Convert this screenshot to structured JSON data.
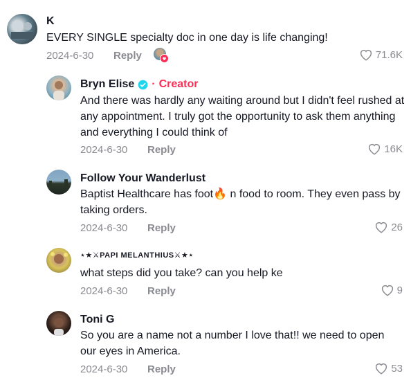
{
  "comments": [
    {
      "author": "K",
      "text": "EVERY SINGLE specialty doc in one day is life changing!",
      "date": "2024-6-30",
      "reply": "Reply",
      "likes": "71.6K"
    },
    {
      "author": "Bryn Elise",
      "creator_sep": "·",
      "creator_label": "Creator",
      "text": "And there was hardly any waiting around but I didn't feel rushed at any appointment. I truly got the opportunity to ask them anything and everything I could think of",
      "date": "2024-6-30",
      "reply": "Reply",
      "likes": "16K"
    },
    {
      "author": "Follow Your Wanderlust",
      "text_before": "Baptist Healthcare has foot",
      "emoji": "🔥",
      "text_after": " n food to room. They even pass by taking orders.",
      "date": "2024-6-30",
      "reply": "Reply",
      "likes": "26"
    },
    {
      "author": "⋆★⚔PAPI MELANTHIUS⚔★⋆",
      "text": "what steps did you take? can you help ke",
      "date": "2024-6-30",
      "reply": "Reply",
      "likes": "9"
    },
    {
      "author": "Toni G",
      "text": "So you are a name not a number I love that!! we need to open our eyes in America.",
      "date": "2024-6-30",
      "reply": "Reply",
      "likes": "53"
    }
  ],
  "colors": {
    "accent": "#fe2c55",
    "muted": "#8a8b91",
    "verified": "#20d5ec"
  }
}
